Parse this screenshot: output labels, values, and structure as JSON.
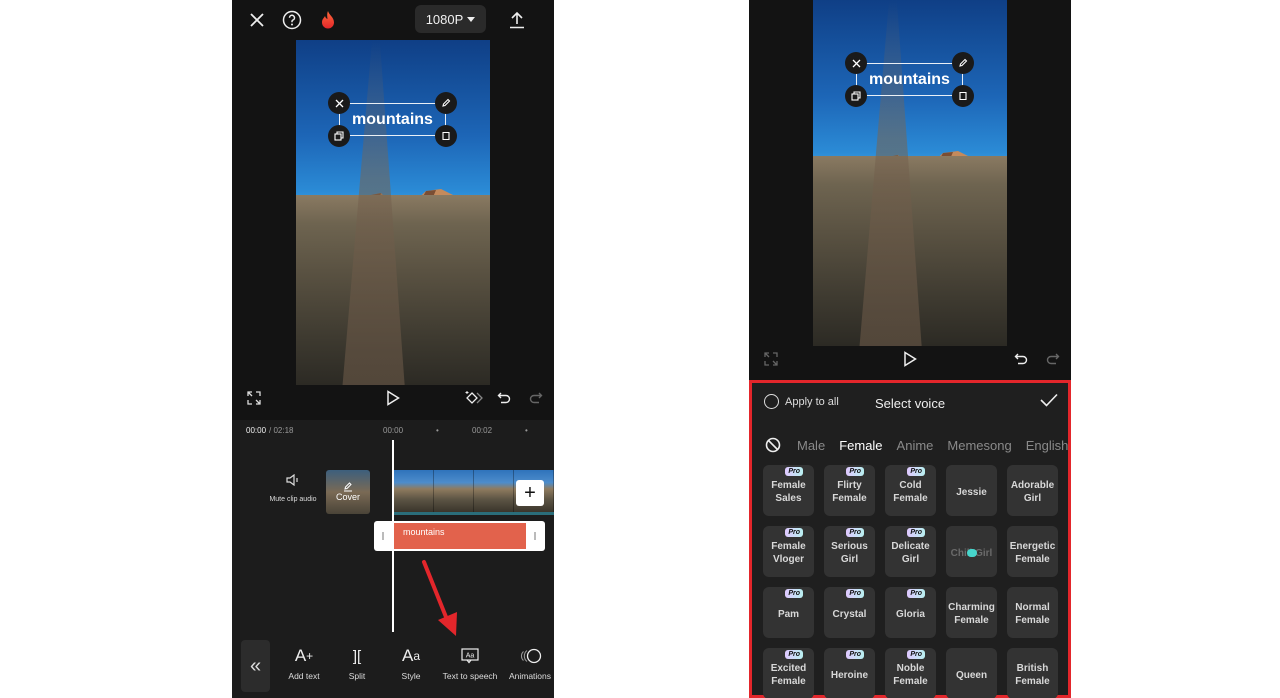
{
  "left": {
    "topbar": {
      "close_icon": "close-icon",
      "help_icon": "help-icon",
      "flame_icon": "flame-icon",
      "resolution": "1080P",
      "export_icon": "upload-icon"
    },
    "preview": {
      "overlay_text": "mountains"
    },
    "ruler": {
      "current": "00:00",
      "total": "/ 02:18",
      "ticks": [
        "00:00",
        "00:02"
      ]
    },
    "timeline": {
      "mute_label": "Mute clip audio",
      "cover_label": "Cover",
      "text_clip": "mountains",
      "add_label": "+"
    },
    "toolbar": {
      "back": "«",
      "tools": [
        {
          "label": "Add text",
          "icon": "add-text-icon"
        },
        {
          "label": "Split",
          "icon": "split-icon"
        },
        {
          "label": "Style",
          "icon": "style-icon"
        },
        {
          "label": "Text to speech",
          "icon": "text-to-speech-icon"
        },
        {
          "label": "Animations",
          "icon": "animations-icon"
        }
      ]
    },
    "annotation": {
      "arrow_color": "#e3262b"
    }
  },
  "right": {
    "preview": {
      "overlay_text": "mountains"
    },
    "voice_panel": {
      "apply_all": "Apply to all",
      "title": "Select voice",
      "highlight_color": "#e3262b",
      "categories": [
        {
          "label": "Male",
          "active": false
        },
        {
          "label": "Female",
          "active": true
        },
        {
          "label": "Anime",
          "active": false
        },
        {
          "label": "Memesong",
          "active": false
        },
        {
          "label": "English",
          "active": false
        }
      ],
      "voices": [
        {
          "name": "Female Sales",
          "pro": true
        },
        {
          "name": "Flirty Female",
          "pro": true
        },
        {
          "name": "Cold Female",
          "pro": true
        },
        {
          "name": "Jessie",
          "pro": false
        },
        {
          "name": "Adorable Girl",
          "pro": false
        },
        {
          "name": "Female Vloger",
          "pro": true
        },
        {
          "name": "Serious Girl",
          "pro": true
        },
        {
          "name": "Delicate Girl",
          "pro": true
        },
        {
          "name": "Chill Girl",
          "pro": false,
          "loading": true
        },
        {
          "name": "Energetic Female",
          "pro": false
        },
        {
          "name": "Pam",
          "pro": true
        },
        {
          "name": "Crystal",
          "pro": true
        },
        {
          "name": "Gloria",
          "pro": true
        },
        {
          "name": "Charming Female",
          "pro": false
        },
        {
          "name": "Normal Female",
          "pro": false
        },
        {
          "name": "Excited Female",
          "pro": true
        },
        {
          "name": "Heroine",
          "pro": true
        },
        {
          "name": "Noble Female",
          "pro": true
        },
        {
          "name": "Queen",
          "pro": false
        },
        {
          "name": "British Female",
          "pro": false
        }
      ],
      "pro_badge": "Pro"
    }
  }
}
